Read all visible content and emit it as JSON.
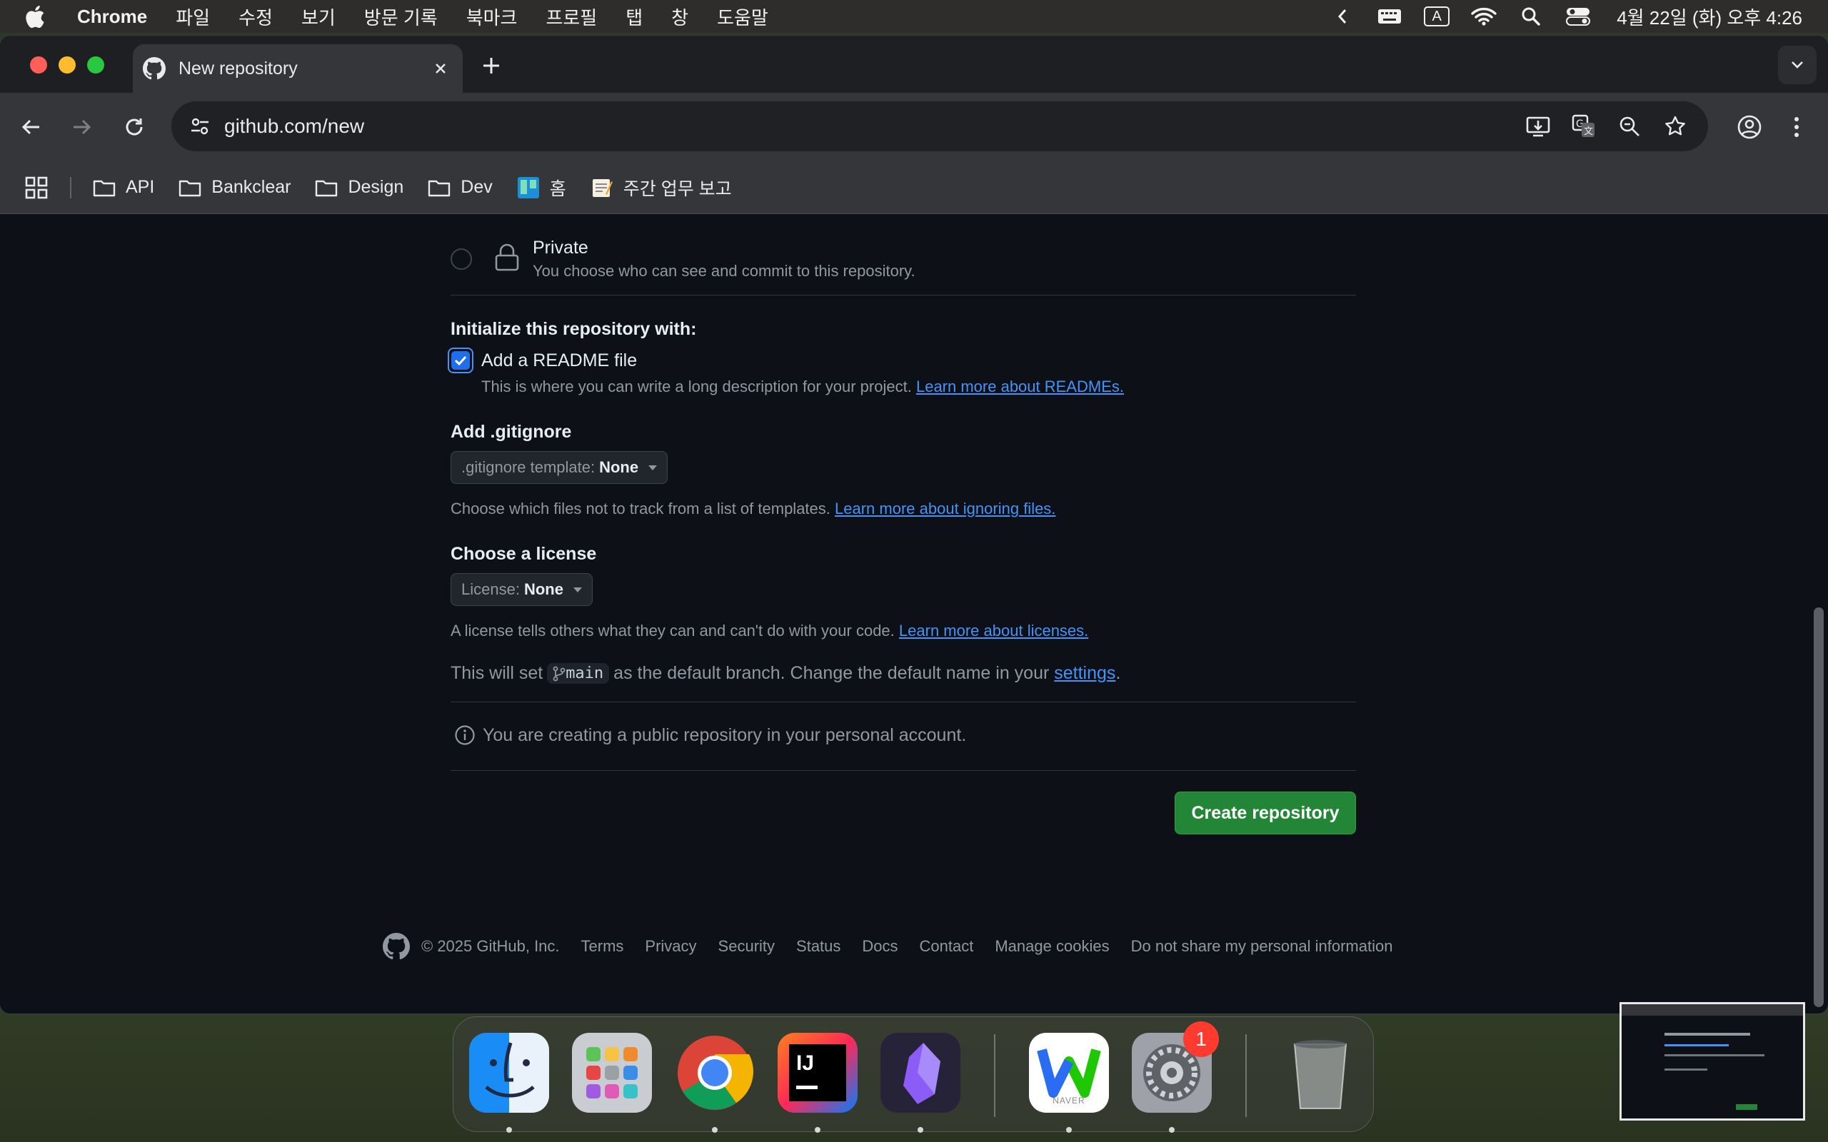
{
  "menubar": {
    "app": "Chrome",
    "items": [
      "파일",
      "수정",
      "보기",
      "방문 기록",
      "북마크",
      "프로필",
      "탭",
      "창",
      "도움말"
    ],
    "clock": "4월 22일 (화) 오후 4:26",
    "input_indicator": "A"
  },
  "browser": {
    "tab_title": "New repository",
    "url": "github.com/new",
    "bookmarks": [
      {
        "label": "API",
        "icon": "folder-icon"
      },
      {
        "label": "Bankclear",
        "icon": "folder-icon"
      },
      {
        "label": "Design",
        "icon": "folder-icon"
      },
      {
        "label": "Dev",
        "icon": "folder-icon"
      },
      {
        "label": "홈",
        "icon": "trello-icon"
      },
      {
        "label": "주간 업무 보고",
        "icon": "memo-icon"
      }
    ]
  },
  "form": {
    "private": {
      "label": "Private",
      "desc": "You choose who can see and commit to this repository."
    },
    "init_heading": "Initialize this repository with:",
    "readme": {
      "label": "Add a README file",
      "checked": true,
      "desc": "This is where you can write a long description for your project.",
      "link": "Learn more about READMEs."
    },
    "gitignore": {
      "heading": "Add .gitignore",
      "select_label": ".gitignore template:",
      "select_value": "None",
      "desc": "Choose which files not to track from a list of templates.",
      "link": "Learn more about ignoring files."
    },
    "license": {
      "heading": "Choose a license",
      "select_label": "License:",
      "select_value": "None",
      "desc": "A license tells others what they can and can't do with your code.",
      "link": "Learn more about licenses."
    },
    "branch": {
      "prefix": "This will set",
      "name": "main",
      "suffix": "as the default branch. Change the default name in your",
      "link": "settings",
      "end": "."
    },
    "notice": "You are creating a public repository in your personal account.",
    "create_button": "Create repository"
  },
  "footer": {
    "copyright": "© 2025 GitHub, Inc.",
    "links": [
      "Terms",
      "Privacy",
      "Security",
      "Status",
      "Docs",
      "Contact",
      "Manage cookies",
      "Do not share my personal information"
    ]
  },
  "dock": {
    "apps": [
      "Finder",
      "Launchpad",
      "Chrome",
      "IntelliJ IDEA",
      "Obsidian",
      "Naver Whale",
      "System Settings",
      "Trash"
    ],
    "badge_system_settings": "1",
    "naver_label": "NAVER"
  },
  "colors": {
    "accent_link": "#4493f8",
    "create_button": "#238636",
    "page_bg": "#0d1117"
  }
}
